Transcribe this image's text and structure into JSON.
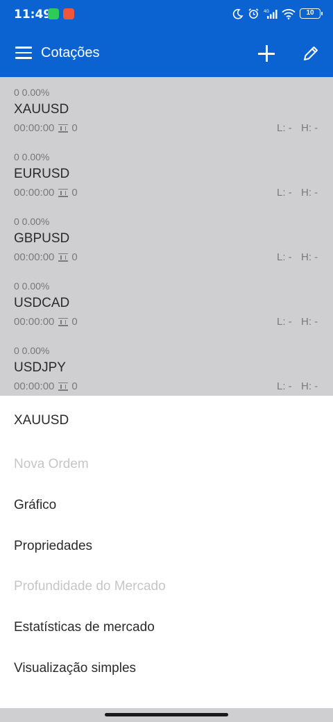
{
  "status_bar": {
    "time": "11:49",
    "notifications": [
      "whatsapp-icon",
      "video-icon"
    ],
    "network": "4G",
    "battery": "10"
  },
  "app_bar": {
    "title": "Cotações",
    "icons": [
      "menu-icon",
      "add-icon",
      "edit-icon"
    ]
  },
  "quotes": [
    {
      "change": "0 0.00%",
      "symbol": "XAUUSD",
      "time": "00:00:00",
      "spread": "0",
      "low": "L: -",
      "high": "H: -"
    },
    {
      "change": "0 0.00%",
      "symbol": "EURUSD",
      "time": "00:00:00",
      "spread": "0",
      "low": "L: -",
      "high": "H: -"
    },
    {
      "change": "0 0.00%",
      "symbol": "GBPUSD",
      "time": "00:00:00",
      "spread": "0",
      "low": "L: -",
      "high": "H: -"
    },
    {
      "change": "0 0.00%",
      "symbol": "USDCAD",
      "time": "00:00:00",
      "spread": "0",
      "low": "L: -",
      "high": "H: -"
    },
    {
      "change": "0 0.00%",
      "symbol": "USDJPY",
      "time": "00:00:00",
      "spread": "0",
      "low": "L: -",
      "high": "H: -"
    }
  ],
  "sheet": {
    "header": "XAUUSD",
    "items": [
      {
        "label": "Nova Ordem",
        "enabled": false
      },
      {
        "label": "Gráfico",
        "enabled": true
      },
      {
        "label": "Propriedades",
        "enabled": true
      },
      {
        "label": "Profundidade do Mercado",
        "enabled": false
      },
      {
        "label": "Estatísticas de mercado",
        "enabled": true
      },
      {
        "label": "Visualização simples",
        "enabled": true
      }
    ]
  },
  "colors": {
    "primary": "#0a63d1",
    "scrim": "#cfcfd1",
    "text": "#2a2a2a",
    "disabled_text": "#c6c6c6"
  }
}
